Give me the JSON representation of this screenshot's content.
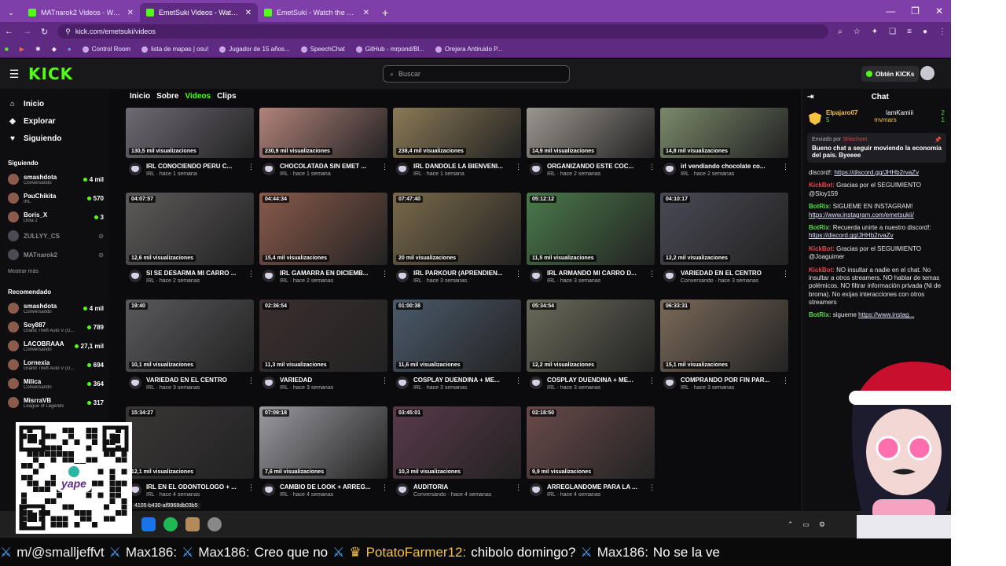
{
  "browser": {
    "tabs": [
      {
        "title": "MATnarok2 Videos - Watch On-",
        "active": false
      },
      {
        "title": "EmetSuki Videos - Watch On-D",
        "active": true
      },
      {
        "title": "EmetSuki - Watch the VOD on",
        "active": false
      }
    ],
    "new_tab": "+",
    "url": "kick.com/emetsuki/videos",
    "bookmarks": [
      "Control Room",
      "lista de mapas | osu!",
      "Jugador de 15 años...",
      "SpeechChat",
      "GitHub - mrpond/Bl...",
      "Orejera Antiruido P..."
    ]
  },
  "header": {
    "logo": "KICK",
    "search_placeholder": "Buscar",
    "kicks_button": "Obtén KICKs"
  },
  "sidebar": {
    "nav": [
      {
        "label": "Inicio",
        "icon": "home-icon",
        "glyph": "⌂"
      },
      {
        "label": "Explorar",
        "icon": "compass-icon",
        "glyph": "◈"
      },
      {
        "label": "Siguiendo",
        "icon": "heart-icon",
        "glyph": "♥"
      }
    ],
    "following_title": "Siguiendo",
    "following": [
      {
        "name": "smashdota",
        "category": "Conversando",
        "viewers": "4 mil",
        "live": true
      },
      {
        "name": "PauChikita",
        "category": "IRL",
        "viewers": "570",
        "live": true
      },
      {
        "name": "Boris_X",
        "category": "Dota 2",
        "viewers": "3",
        "live": true
      },
      {
        "name": "ZULLYY_CS",
        "category": "",
        "viewers": "",
        "live": false
      },
      {
        "name": "MATnarok2",
        "category": "",
        "viewers": "",
        "live": false
      }
    ],
    "show_more": "Mostrar más",
    "recommended_title": "Recomendado",
    "recommended": [
      {
        "name": "smashdota",
        "category": "Conversando",
        "viewers": "4 mil"
      },
      {
        "name": "Soy887",
        "category": "Grand Theft Auto V (G...",
        "viewers": "789"
      },
      {
        "name": "LACOBRAAA",
        "category": "Conversando",
        "viewers": "27,1 mil"
      },
      {
        "name": "Lornexia",
        "category": "Grand Theft Auto V (G...",
        "viewers": "694"
      },
      {
        "name": "Milica",
        "category": "Conversando",
        "viewers": "364"
      },
      {
        "name": "MisrraVB",
        "category": "League of Legends",
        "viewers": "317"
      }
    ]
  },
  "page_tabs": [
    {
      "label": "Inicio",
      "active": false
    },
    {
      "label": "Sobre",
      "active": false
    },
    {
      "label": "Videos",
      "active": true
    },
    {
      "label": "Clips",
      "active": false
    }
  ],
  "videos": [
    {
      "duration": "",
      "views": "130,5 mil visualizaciones",
      "title": "IRL CONOCIENDO PERU C...",
      "sub": "IRL · hace 1 semana",
      "color": "#6f6a74"
    },
    {
      "duration": "",
      "views": "230,9 mil visualizaciones",
      "title": "CHOCOLATADA SIN EMET ...",
      "sub": "IRL · hace 1 semana",
      "color": "#b2837a"
    },
    {
      "duration": "",
      "views": "238,4 mil visualizaciones",
      "title": "IRL DANDOLE LA BIENVENI...",
      "sub": "IRL · hace 1 semana",
      "color": "#8a7a56"
    },
    {
      "duration": "",
      "views": "14,9 mil visualizaciones",
      "title": "ORGANIZANDO ESTE COC...",
      "sub": "IRL · hace 2 semanas",
      "color": "#9c9690"
    },
    {
      "duration": "",
      "views": "14,8 mil visualizaciones",
      "title": "irl vendiando chocolate co...",
      "sub": "IRL · hace 2 semanas",
      "color": "#7a8a6a"
    },
    {
      "duration": "04:07:57",
      "views": "12,6 mil visualizaciones",
      "title": "SI SE DESARMA MI CARRO ...",
      "sub": "IRL · hace 2 semanas",
      "color": "#5e5a5a"
    },
    {
      "duration": "04:44:34",
      "views": "15,4 mil visualizaciones",
      "title": "IRL GAMARRA EN DICIEMB...",
      "sub": "IRL · hace 2 semanas",
      "color": "#8a5a4a"
    },
    {
      "duration": "07:47:40",
      "views": "20 mil visualizaciones",
      "title": "IRL PARKOUR (APRENDIEN...",
      "sub": "IRL · hace 3 semanas",
      "color": "#7a6a4a"
    },
    {
      "duration": "05:12:12",
      "views": "11,5 mil visualizaciones",
      "title": "IRL ARMANDO MI CARRO D...",
      "sub": "IRL · hace 3 semanas",
      "color": "#4a7a4a"
    },
    {
      "duration": "04:10:17",
      "views": "12,2 mil visualizaciones",
      "title": "VARIEDAD EN EL CENTRO",
      "sub": "Conversando · hace 3 semanas",
      "color": "#4a4a55"
    },
    {
      "duration": "19:40",
      "views": "10,1 mil visualizaciones",
      "title": "VARIEDAD EN EL CENTRO",
      "sub": "IRL · hace 3 semanas",
      "color": "#5a5a5e"
    },
    {
      "duration": "02:36:54",
      "views": "11,3 mil visualizaciones",
      "title": "VARIEDAD",
      "sub": "IRL · hace 3 semanas",
      "color": "#3a2e2e"
    },
    {
      "duration": "01:00:38",
      "views": "11,6 mil visualizaciones",
      "title": "COSPLAY DUENDINA + ME...",
      "sub": "IRL · hace 3 semanas",
      "color": "#4a5a6a"
    },
    {
      "duration": "05:34:54",
      "views": "12,2 mil visualizaciones",
      "title": "COSPLAY DUENDINA + ME...",
      "sub": "IRL · hace 3 semanas",
      "color": "#6a6a5a"
    },
    {
      "duration": "06:33:31",
      "views": "15,1 mil visualizaciones",
      "title": "COMPRANDO POR FIN PAR...",
      "sub": "IRL · hace 3 semanas",
      "color": "#7a6a5a"
    },
    {
      "duration": "15:34:27",
      "views": "12,1 mil visualizaciones",
      "title": "IRL EN EL ODONTOLOGO + ...",
      "sub": "IRL · hace 4 semanas",
      "color": "#3a3636"
    },
    {
      "duration": "07:09:18",
      "views": "7,6 mil visualizaciones",
      "title": "CAMBIO DE LOOK + ARREG...",
      "sub": "IRL · hace 4 semanas",
      "color": "#9a9aa0"
    },
    {
      "duration": "03:45:01",
      "views": "10,3 mil visualizaciones",
      "title": "AUDITORIA",
      "sub": "Conversando · hace 4 semanas",
      "color": "#5a3a4a"
    },
    {
      "duration": "02:18:50",
      "views": "9,9 mil visualizaciones",
      "title": "ARREGLANDOME PARA LA ...",
      "sub": "IRL · hace 4 semanas",
      "color": "#6a4a4a"
    }
  ],
  "chat": {
    "title": "Chat",
    "leaders": [
      {
        "name": "Elpajaro07",
        "count": "5"
      },
      {
        "name": "IamKamiii",
        "count": "2"
      },
      {
        "name": "mvmars",
        "count": "1"
      }
    ],
    "pinned_by": "Enviado por",
    "pinned_user": "Shiochom",
    "pinned_text": "Bueno chat a seguir moviendo la economía del país. Byeeee",
    "messages": [
      {
        "user": "",
        "text": "discord!: ",
        "link": "https://discord.gg/JHHb2rvaZv",
        "red": false
      },
      {
        "user": "KickBot:",
        "text": "Gracias por el SEGUIMIENTO @Sloy159",
        "link": "",
        "red": true
      },
      {
        "user": "BotRix:",
        "text": "SIGUEME EN INSTAGRAM! ",
        "link": "https://www.instagram.com/emetsukii/",
        "red": false
      },
      {
        "user": "BotRix:",
        "text": "Recuerda unirte a nuestro discord!: ",
        "link": "https://discord.gg/JHHb2rvaZv",
        "red": false
      },
      {
        "user": "KickBot:",
        "text": "Gracias por el SEGUIMIENTO @Joaguimer",
        "link": "",
        "red": true
      },
      {
        "user": "KickBot:",
        "text": "NO insultar a nadie en el chat. No insultar a otros streamers. NO hablar de temas polémicos. NO filtrar información privada (Ni de broma). No exijas interacciones con otros streamers",
        "link": "",
        "red": true
      },
      {
        "user": "BotRix:",
        "text": "sigueme ",
        "link": "https://www.instag...",
        "red": false
      }
    ]
  },
  "taskbar": {
    "hash_text": "4105-b430-af9968db03b5"
  },
  "ticker": [
    {
      "name": "m/@smalljeffvt",
      "text": "",
      "sword": true,
      "gold": false
    },
    {
      "name": "Max186:",
      "text": "",
      "sword": true,
      "gold": false
    },
    {
      "name": "Max186:",
      "text": "Creo que no",
      "sword": true,
      "gold": false
    },
    {
      "name": "PotatoFarmer12:",
      "text": "chibolo domingo?",
      "sword": true,
      "gold": true
    },
    {
      "name": "Max186:",
      "text": "No se la ve",
      "sword": true,
      "gold": false
    }
  ]
}
